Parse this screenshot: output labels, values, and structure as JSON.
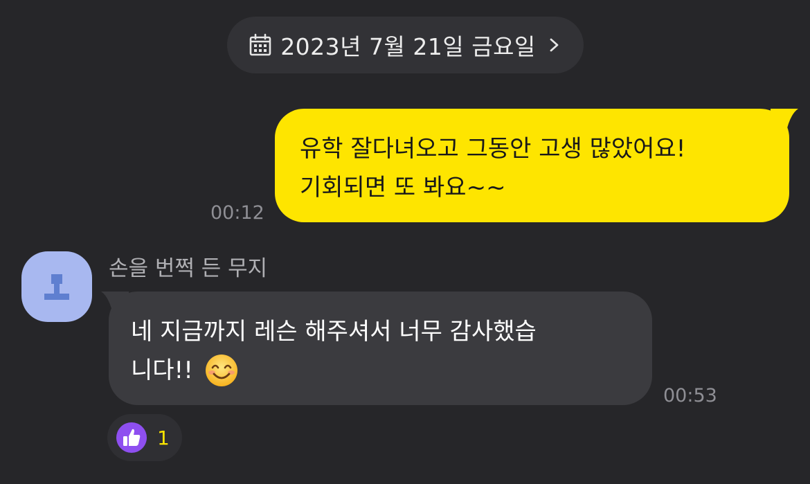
{
  "date_divider": {
    "label": "2023년 7월 21일 금요일",
    "icon": "calendar-icon",
    "chevron": "chevron-right-icon"
  },
  "messages": [
    {
      "direction": "outgoing",
      "lines": [
        "유학 잘다녀오고 그동안 고생 많았어요!",
        "기회되면 또 봐요~~"
      ],
      "time": "00:12",
      "bubble_color": "#fee500"
    },
    {
      "direction": "incoming",
      "sender": "손을 번쩍 든 무지",
      "lines": [
        "네 지금까지 레슨 해주셔서 너무 감사했습",
        "니다!!"
      ],
      "emoji": "smiling-face-icon",
      "time": "00:53",
      "bubble_color": "#3b3b3f",
      "reaction": {
        "icon": "thumbs-up-icon",
        "count": "1",
        "accent": "#8e4ff0"
      }
    }
  ]
}
